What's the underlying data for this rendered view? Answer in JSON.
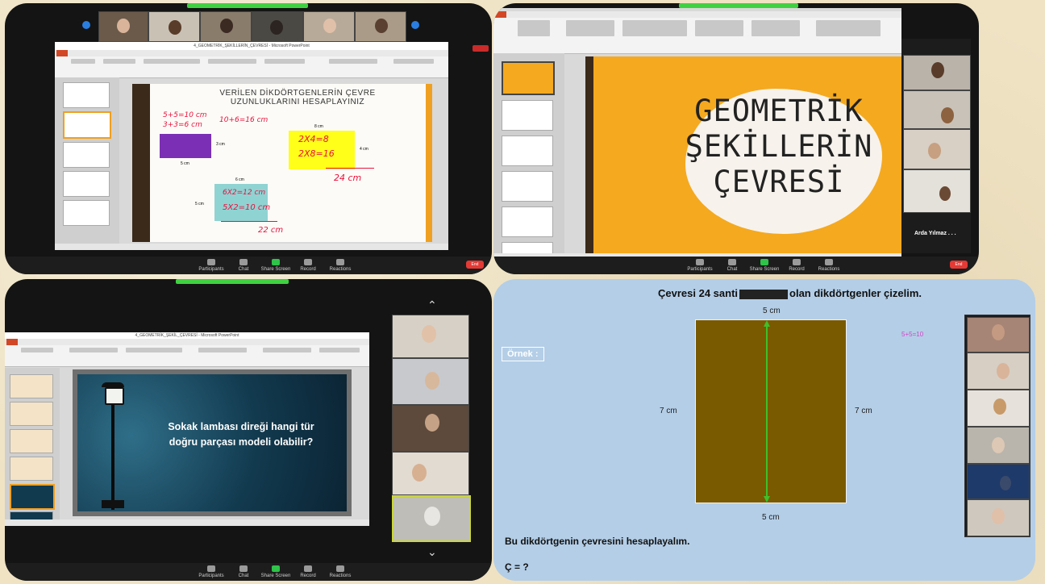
{
  "panel1": {
    "window_title": "4_GEOMETRİK_ŞEKİLLERİN_ÇEVRESİ - Microsoft PowerPoint",
    "slide_title_line1": "VERİLEN DİKDÖRTGENLERİN ÇEVRE",
    "slide_title_line2": "UZUNLUKLARINI HESAPLAYINIZ",
    "purple_rect_height": "3 cm",
    "purple_rect_width": "5 cm",
    "yellow_rect_top": "8 cm",
    "yellow_rect_side": "4 cm",
    "teal_rect_top": "6 cm",
    "teal_rect_side": "5 cm",
    "hw_line1": "5+5=10 cm",
    "hw_line2": "3+3=6 cm",
    "hw_line3": "10+6=16 cm",
    "hw_yellow1": "2X4=8",
    "hw_yellow2": "2X8=16",
    "hw_yellow_total": "24 cm",
    "hw_teal1": "6X2=12 cm",
    "hw_teal2": "5X2=10 cm",
    "hw_teal_total": "22 cm",
    "colors": {
      "purple": "#7a2fb4",
      "yellow": "#ffff19",
      "teal": "#8fd3d3",
      "ink": "#e8123c"
    }
  },
  "panel2": {
    "slide_title_line1": "GEOMETRİK",
    "slide_title_line2": "ŞEKİLLERİN",
    "slide_title_line3": "ÇEVRESİ",
    "participant_name": "Arda Yılmaz . . .",
    "colors": {
      "slide_bg": "#f4a91e",
      "blob": "#f7f3ec"
    }
  },
  "panel3": {
    "window_title": "4_GEOMETRİK_ŞEKİL_ÇEVRESİ - Microsoft PowerPoint",
    "slide_text_line1": "Sokak lambası direği hangi tür",
    "slide_text_line2": "doğru parçası modeli olabilir?",
    "colors": {
      "slide_bg": "#123a4f"
    }
  },
  "panel4": {
    "heading_prefix": "Çevresi 24 santi",
    "heading_suffix": "olan dikdörtgenler çizelim.",
    "example_label": "Örnek :",
    "top_label": "5 cm",
    "bottom_label": "5 cm",
    "left_label": "7 cm",
    "right_label": "7 cm",
    "pink_note": "5+5=10",
    "bottom_text": "Bu dikdörtgenin çevresini hesaplayalım.",
    "formula": "Ç = ?",
    "colors": {
      "bg": "#b3cee6",
      "rect": "#7a5a00",
      "arrow": "#3fbf2a",
      "note": "#d447c9"
    }
  },
  "zoom_toolbar": {
    "participants": "Participants",
    "chat": "Chat",
    "share_screen": "Share Screen",
    "record": "Record",
    "reactions": "Reactions",
    "end": "End"
  }
}
